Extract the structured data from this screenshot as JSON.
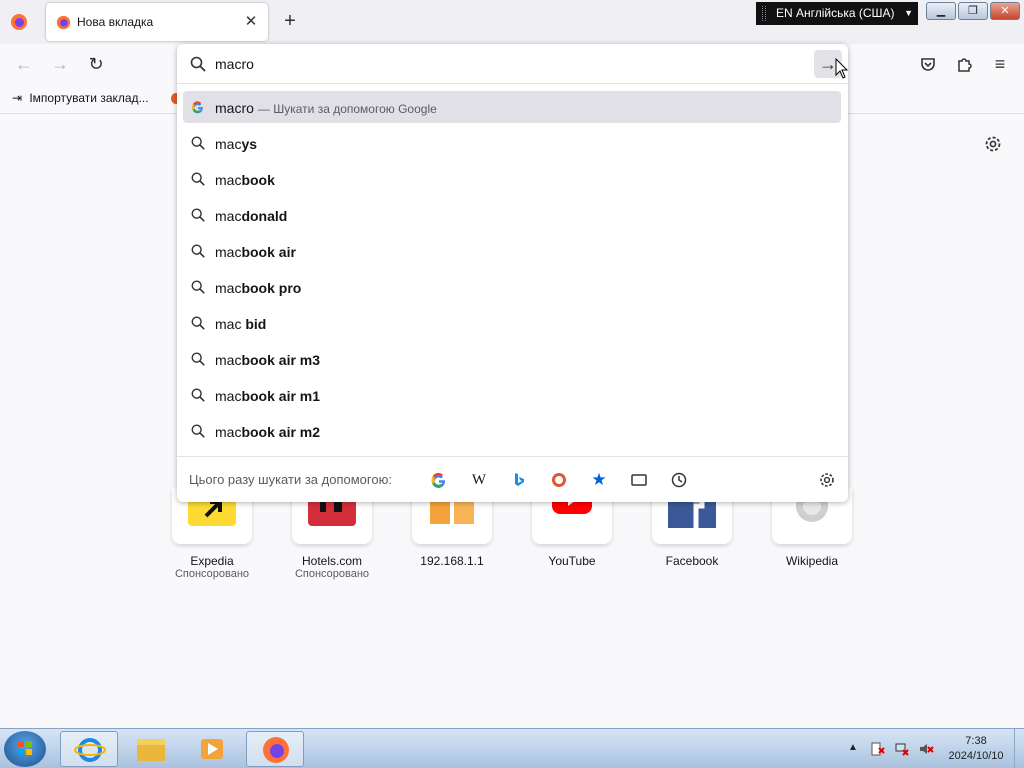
{
  "tab": {
    "title": "Нова вкладка"
  },
  "language_indicator": "EN Англійська (США)",
  "bookmarks": {
    "import_label": "Імпортувати заклад..."
  },
  "urlbar": {
    "value": "macro",
    "results": [
      {
        "typed": "macro",
        "rest": "",
        "action": "— Шукати за допомогою Google",
        "icon": "google-icon",
        "selected": true
      },
      {
        "typed": "mac",
        "rest": "ys",
        "icon": "search-icon"
      },
      {
        "typed": "mac",
        "rest": "book",
        "icon": "search-icon"
      },
      {
        "typed": "mac",
        "rest": "donald",
        "icon": "search-icon"
      },
      {
        "typed": "mac",
        "rest": "book air",
        "icon": "search-icon"
      },
      {
        "typed": "mac",
        "rest": "book pro",
        "icon": "search-icon"
      },
      {
        "typed": "mac ",
        "rest": "bid",
        "icon": "search-icon"
      },
      {
        "typed": "mac",
        "rest": "book air m3",
        "icon": "search-icon"
      },
      {
        "typed": "mac",
        "rest": "book air m1",
        "icon": "search-icon"
      },
      {
        "typed": "mac",
        "rest": "book air m2",
        "icon": "search-icon"
      }
    ],
    "engines_label": "Цього разу шукати за допомогою:",
    "engines": [
      "google",
      "wikipedia",
      "bing",
      "duckduckgo",
      "bookmarks",
      "tabs",
      "history"
    ]
  },
  "top_sites": [
    {
      "name": "Expedia",
      "sponsored": "Спонсоровано"
    },
    {
      "name": "Hotels.com",
      "sponsored": "Спонсоровано"
    },
    {
      "name": "192.168.1.1",
      "sponsored": ""
    },
    {
      "name": "YouTube",
      "sponsored": ""
    },
    {
      "name": "Facebook",
      "sponsored": ""
    },
    {
      "name": "Wikipedia",
      "sponsored": ""
    }
  ],
  "clock": {
    "time": "7:38",
    "date": "2024/10/10"
  }
}
